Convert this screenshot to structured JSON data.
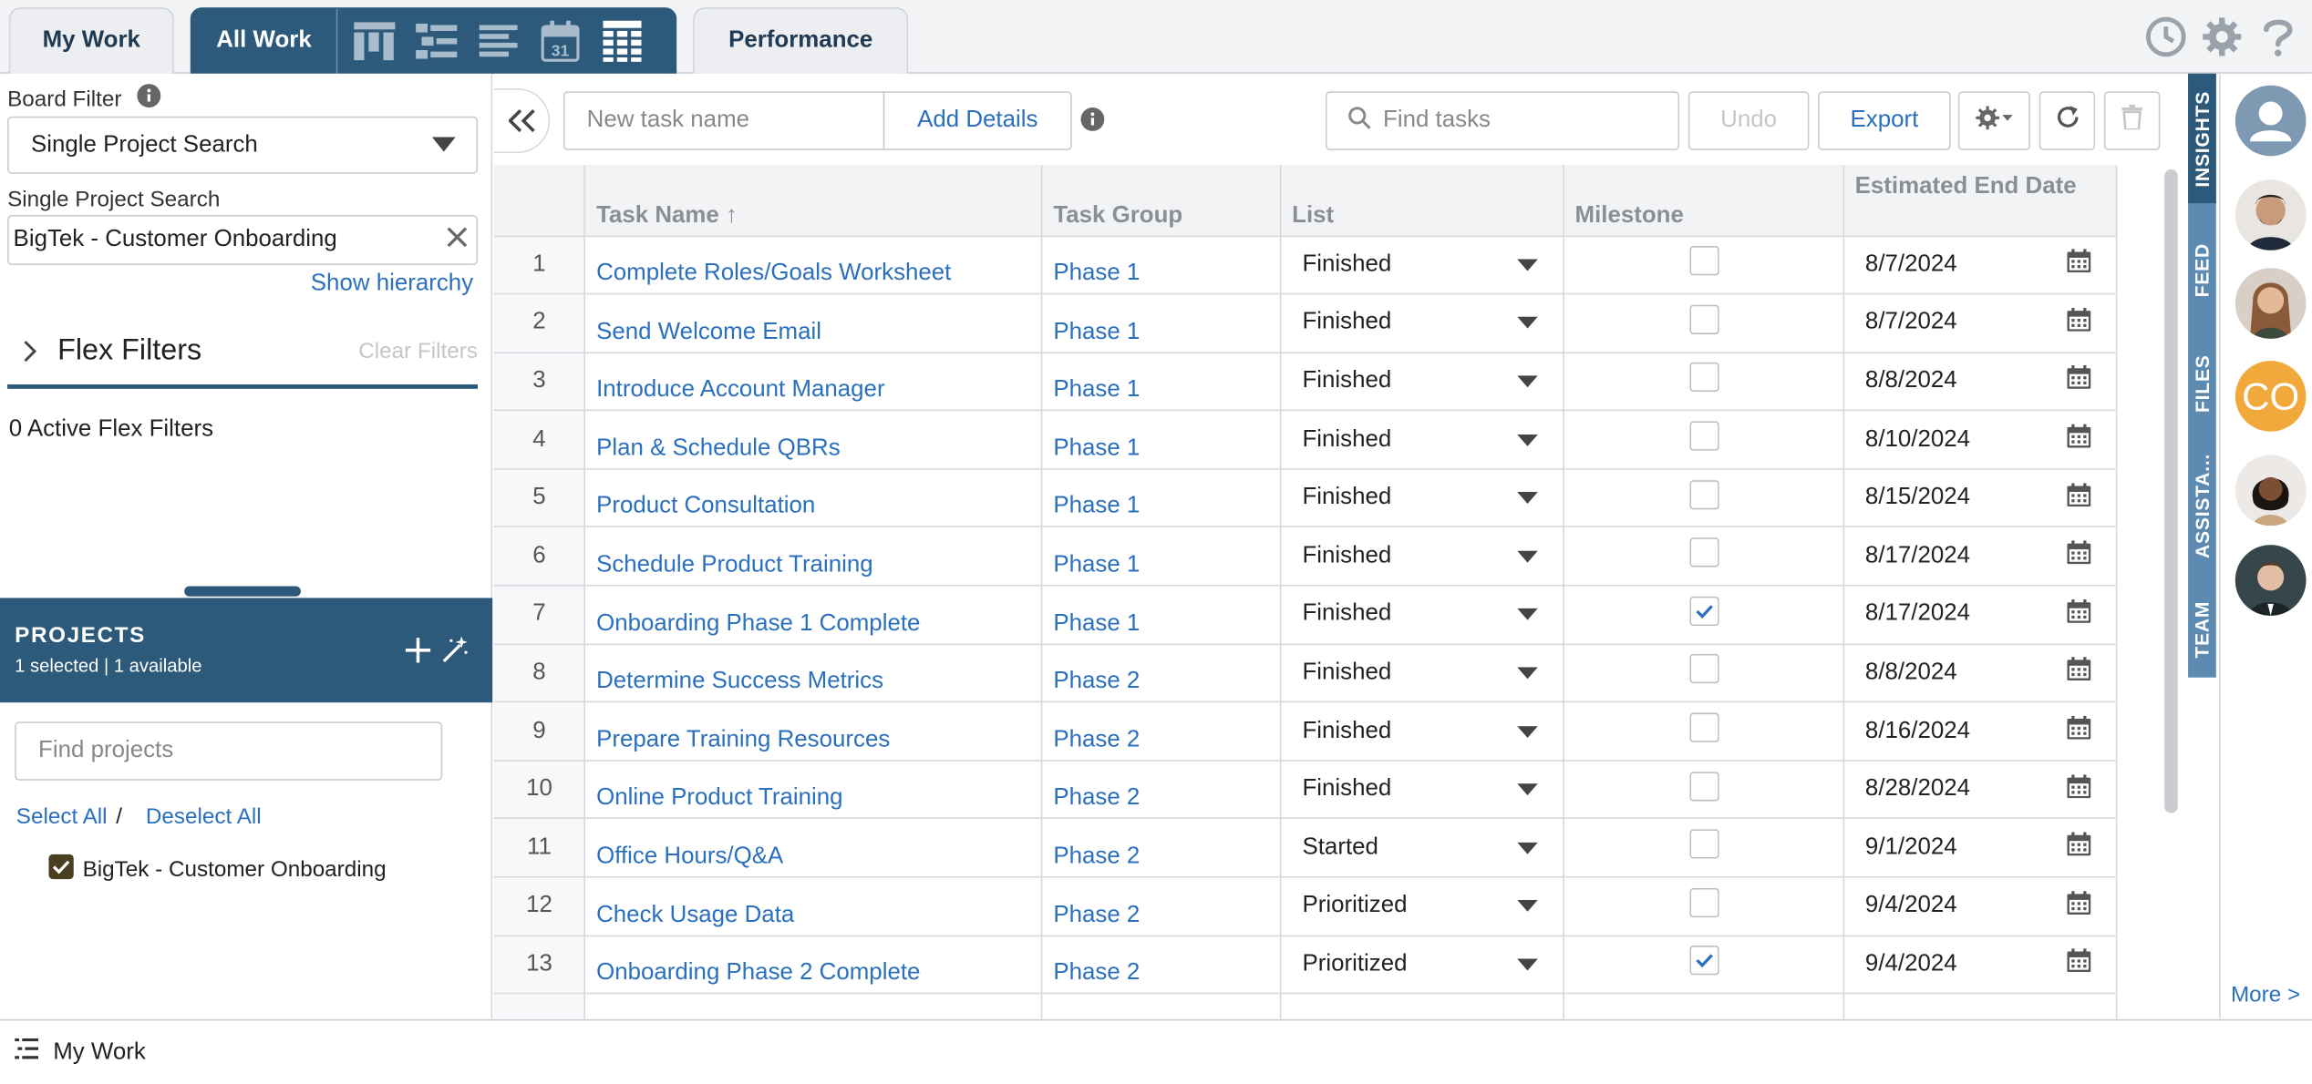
{
  "tabs": {
    "my_work": "My Work",
    "all_work": "All Work",
    "performance": "Performance",
    "calendar_day": "31"
  },
  "board_filter": {
    "label": "Board Filter",
    "selected": "Single Project Search",
    "search_label": "Single Project Search",
    "search_value": "BigTek - Customer Onboarding",
    "show_hierarchy": "Show hierarchy",
    "flex_filters": "Flex Filters",
    "clear_filters": "Clear Filters",
    "active_flex_filters": "0 Active Flex Filters"
  },
  "projects": {
    "title": "PROJECTS",
    "subtitle": "1 selected | 1 available",
    "find_placeholder": "Find projects",
    "select_all": "Select All",
    "separator": "/",
    "deselect_all": "Deselect All",
    "items": [
      {
        "label": "BigTek - Customer Onboarding",
        "checked": true
      }
    ]
  },
  "toolbar": {
    "new_task_placeholder": "New task name",
    "add_details": "Add Details",
    "find_tasks_placeholder": "Find tasks",
    "undo": "Undo",
    "export": "Export"
  },
  "grid": {
    "columns": {
      "task_name": "Task Name ↑",
      "task_group": "Task Group",
      "list": "List",
      "milestone": "Milestone",
      "estimated_end_date": "Estimated End Date"
    },
    "rows": [
      {
        "num": "1",
        "task": "Complete Roles/Goals Worksheet",
        "group": "Phase 1",
        "list": "Finished",
        "milestone": false,
        "date": "8/7/2024"
      },
      {
        "num": "2",
        "task": "Send Welcome Email",
        "group": "Phase 1",
        "list": "Finished",
        "milestone": false,
        "date": "8/7/2024"
      },
      {
        "num": "3",
        "task": "Introduce Account Manager",
        "group": "Phase 1",
        "list": "Finished",
        "milestone": false,
        "date": "8/8/2024"
      },
      {
        "num": "4",
        "task": "Plan & Schedule QBRs",
        "group": "Phase 1",
        "list": "Finished",
        "milestone": false,
        "date": "8/10/2024"
      },
      {
        "num": "5",
        "task": "Product Consultation",
        "group": "Phase 1",
        "list": "Finished",
        "milestone": false,
        "date": "8/15/2024"
      },
      {
        "num": "6",
        "task": "Schedule Product Training",
        "group": "Phase 1",
        "list": "Finished",
        "milestone": false,
        "date": "8/17/2024"
      },
      {
        "num": "7",
        "task": "Onboarding Phase 1 Complete",
        "group": "Phase 1",
        "list": "Finished",
        "milestone": true,
        "date": "8/17/2024"
      },
      {
        "num": "8",
        "task": "Determine Success Metrics",
        "group": "Phase 2",
        "list": "Finished",
        "milestone": false,
        "date": "8/8/2024"
      },
      {
        "num": "9",
        "task": "Prepare Training Resources",
        "group": "Phase 2",
        "list": "Finished",
        "milestone": false,
        "date": "8/16/2024"
      },
      {
        "num": "10",
        "task": "Online Product Training",
        "group": "Phase 2",
        "list": "Finished",
        "milestone": false,
        "date": "8/28/2024"
      },
      {
        "num": "11",
        "task": "Office Hours/Q&A",
        "group": "Phase 2",
        "list": "Started",
        "milestone": false,
        "date": "9/1/2024"
      },
      {
        "num": "12",
        "task": "Check Usage Data",
        "group": "Phase 2",
        "list": "Prioritized",
        "milestone": false,
        "date": "9/4/2024"
      },
      {
        "num": "13",
        "task": "Onboarding Phase 2 Complete",
        "group": "Phase 2",
        "list": "Prioritized",
        "milestone": true,
        "date": "9/4/2024"
      }
    ]
  },
  "side_tabs": [
    "INSIGHTS",
    "FEED",
    "FILES",
    "ASSISTA...",
    "TEAM"
  ],
  "avatars": {
    "initials": "CO",
    "more": "More >"
  },
  "bottom_bar": {
    "label": "My Work"
  },
  "colors": {
    "primary": "#2d5a7b",
    "link": "#2b6fbf",
    "side_tab": "#5d8ab0",
    "avatar_co": "#f2a93b",
    "checkbox_checked": "#4a4020"
  }
}
